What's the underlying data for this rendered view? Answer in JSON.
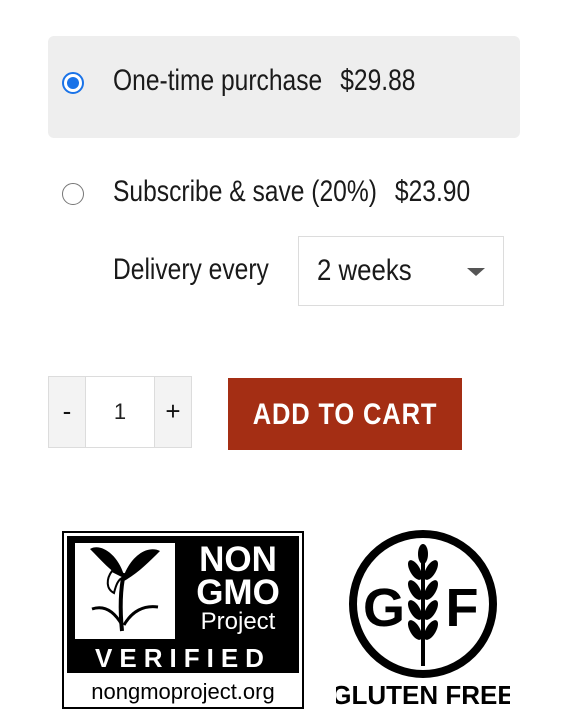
{
  "purchase_options": {
    "one_time": {
      "label": "One-time purchase",
      "price": "$29.88",
      "selected": true
    },
    "subscribe": {
      "label": "Subscribe & save (20%)",
      "price": "$23.90",
      "selected": false
    },
    "delivery_label": "Delivery every",
    "delivery_selected": "2 weeks"
  },
  "cart": {
    "minus_label": "-",
    "quantity": "1",
    "plus_label": "+",
    "add_to_cart_label": "ADD TO CART"
  },
  "badges": {
    "non_gmo": {
      "line1": "NON",
      "line2": "GMO",
      "line3": "Project",
      "verified": "VERIFIED",
      "url": "nongmoproject.org"
    },
    "gluten_free": {
      "letter_left": "G",
      "letter_right": "F",
      "label": "GLUTEN FREE"
    }
  },
  "colors": {
    "radio_accent": "#1a73e8",
    "cart_button": "#a42e14",
    "option_bg": "#eeeeee"
  }
}
